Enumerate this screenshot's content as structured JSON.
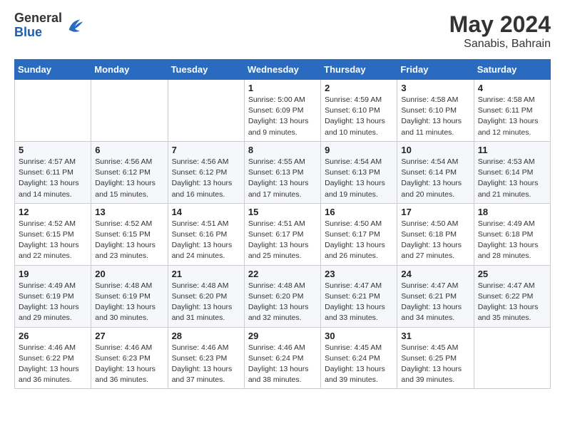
{
  "header": {
    "logo": {
      "general": "General",
      "blue": "Blue"
    },
    "title": "May 2024",
    "location": "Sanabis, Bahrain"
  },
  "weekdays": [
    "Sunday",
    "Monday",
    "Tuesday",
    "Wednesday",
    "Thursday",
    "Friday",
    "Saturday"
  ],
  "weeks": [
    [
      {
        "day": "",
        "info": ""
      },
      {
        "day": "",
        "info": ""
      },
      {
        "day": "",
        "info": ""
      },
      {
        "day": "1",
        "info": "Sunrise: 5:00 AM\nSunset: 6:09 PM\nDaylight: 13 hours\nand 9 minutes."
      },
      {
        "day": "2",
        "info": "Sunrise: 4:59 AM\nSunset: 6:10 PM\nDaylight: 13 hours\nand 10 minutes."
      },
      {
        "day": "3",
        "info": "Sunrise: 4:58 AM\nSunset: 6:10 PM\nDaylight: 13 hours\nand 11 minutes."
      },
      {
        "day": "4",
        "info": "Sunrise: 4:58 AM\nSunset: 6:11 PM\nDaylight: 13 hours\nand 12 minutes."
      }
    ],
    [
      {
        "day": "5",
        "info": "Sunrise: 4:57 AM\nSunset: 6:11 PM\nDaylight: 13 hours\nand 14 minutes."
      },
      {
        "day": "6",
        "info": "Sunrise: 4:56 AM\nSunset: 6:12 PM\nDaylight: 13 hours\nand 15 minutes."
      },
      {
        "day": "7",
        "info": "Sunrise: 4:56 AM\nSunset: 6:12 PM\nDaylight: 13 hours\nand 16 minutes."
      },
      {
        "day": "8",
        "info": "Sunrise: 4:55 AM\nSunset: 6:13 PM\nDaylight: 13 hours\nand 17 minutes."
      },
      {
        "day": "9",
        "info": "Sunrise: 4:54 AM\nSunset: 6:13 PM\nDaylight: 13 hours\nand 19 minutes."
      },
      {
        "day": "10",
        "info": "Sunrise: 4:54 AM\nSunset: 6:14 PM\nDaylight: 13 hours\nand 20 minutes."
      },
      {
        "day": "11",
        "info": "Sunrise: 4:53 AM\nSunset: 6:14 PM\nDaylight: 13 hours\nand 21 minutes."
      }
    ],
    [
      {
        "day": "12",
        "info": "Sunrise: 4:52 AM\nSunset: 6:15 PM\nDaylight: 13 hours\nand 22 minutes."
      },
      {
        "day": "13",
        "info": "Sunrise: 4:52 AM\nSunset: 6:15 PM\nDaylight: 13 hours\nand 23 minutes."
      },
      {
        "day": "14",
        "info": "Sunrise: 4:51 AM\nSunset: 6:16 PM\nDaylight: 13 hours\nand 24 minutes."
      },
      {
        "day": "15",
        "info": "Sunrise: 4:51 AM\nSunset: 6:17 PM\nDaylight: 13 hours\nand 25 minutes."
      },
      {
        "day": "16",
        "info": "Sunrise: 4:50 AM\nSunset: 6:17 PM\nDaylight: 13 hours\nand 26 minutes."
      },
      {
        "day": "17",
        "info": "Sunrise: 4:50 AM\nSunset: 6:18 PM\nDaylight: 13 hours\nand 27 minutes."
      },
      {
        "day": "18",
        "info": "Sunrise: 4:49 AM\nSunset: 6:18 PM\nDaylight: 13 hours\nand 28 minutes."
      }
    ],
    [
      {
        "day": "19",
        "info": "Sunrise: 4:49 AM\nSunset: 6:19 PM\nDaylight: 13 hours\nand 29 minutes."
      },
      {
        "day": "20",
        "info": "Sunrise: 4:48 AM\nSunset: 6:19 PM\nDaylight: 13 hours\nand 30 minutes."
      },
      {
        "day": "21",
        "info": "Sunrise: 4:48 AM\nSunset: 6:20 PM\nDaylight: 13 hours\nand 31 minutes."
      },
      {
        "day": "22",
        "info": "Sunrise: 4:48 AM\nSunset: 6:20 PM\nDaylight: 13 hours\nand 32 minutes."
      },
      {
        "day": "23",
        "info": "Sunrise: 4:47 AM\nSunset: 6:21 PM\nDaylight: 13 hours\nand 33 minutes."
      },
      {
        "day": "24",
        "info": "Sunrise: 4:47 AM\nSunset: 6:21 PM\nDaylight: 13 hours\nand 34 minutes."
      },
      {
        "day": "25",
        "info": "Sunrise: 4:47 AM\nSunset: 6:22 PM\nDaylight: 13 hours\nand 35 minutes."
      }
    ],
    [
      {
        "day": "26",
        "info": "Sunrise: 4:46 AM\nSunset: 6:22 PM\nDaylight: 13 hours\nand 36 minutes."
      },
      {
        "day": "27",
        "info": "Sunrise: 4:46 AM\nSunset: 6:23 PM\nDaylight: 13 hours\nand 36 minutes."
      },
      {
        "day": "28",
        "info": "Sunrise: 4:46 AM\nSunset: 6:23 PM\nDaylight: 13 hours\nand 37 minutes."
      },
      {
        "day": "29",
        "info": "Sunrise: 4:46 AM\nSunset: 6:24 PM\nDaylight: 13 hours\nand 38 minutes."
      },
      {
        "day": "30",
        "info": "Sunrise: 4:45 AM\nSunset: 6:24 PM\nDaylight: 13 hours\nand 39 minutes."
      },
      {
        "day": "31",
        "info": "Sunrise: 4:45 AM\nSunset: 6:25 PM\nDaylight: 13 hours\nand 39 minutes."
      },
      {
        "day": "",
        "info": ""
      }
    ]
  ]
}
